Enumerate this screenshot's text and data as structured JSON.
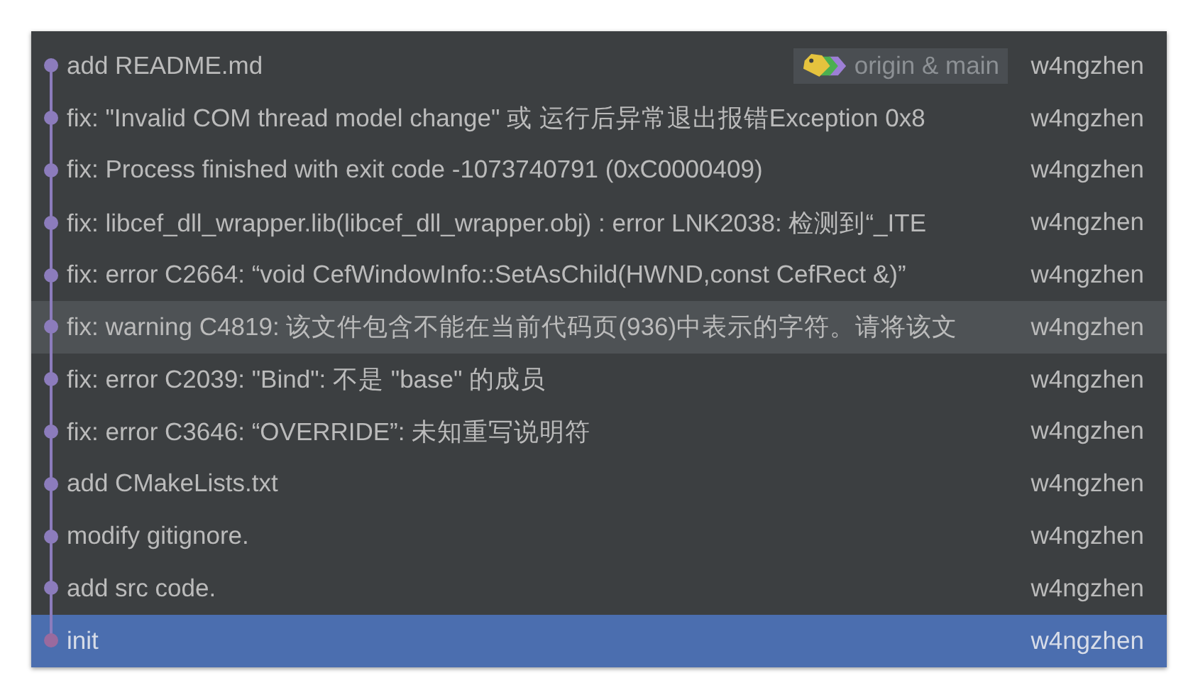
{
  "commits": [
    {
      "message": "add README.md",
      "ref": "origin & main",
      "author": "w4ngzhen",
      "selected": false,
      "hovered": false
    },
    {
      "message": "fix: \"Invalid COM thread model change\" 或 运行后异常退出报错Exception 0x8",
      "author": "w4ngzhen",
      "selected": false,
      "hovered": false
    },
    {
      "message": "fix: Process finished with exit code -1073740791 (0xC0000409)",
      "author": "w4ngzhen",
      "selected": false,
      "hovered": false
    },
    {
      "message": "fix: libcef_dll_wrapper.lib(libcef_dll_wrapper.obj) : error LNK2038: 检测到“_ITE",
      "author": "w4ngzhen",
      "selected": false,
      "hovered": false
    },
    {
      "message": "fix: error C2664: “void CefWindowInfo::SetAsChild(HWND,const CefRect &)”",
      "author": "w4ngzhen",
      "selected": false,
      "hovered": false
    },
    {
      "message": "fix: warning C4819: 该文件包含不能在当前代码页(936)中表示的字符。请将该文",
      "author": "w4ngzhen",
      "selected": false,
      "hovered": true
    },
    {
      "message": "fix: error C2039: \"Bind\": 不是 \"base\" 的成员",
      "author": "w4ngzhen",
      "selected": false,
      "hovered": false
    },
    {
      "message": "fix: error C3646: “OVERRIDE”: 未知重写说明符",
      "author": "w4ngzhen",
      "selected": false,
      "hovered": false
    },
    {
      "message": "add CMakeLists.txt",
      "author": "w4ngzhen",
      "selected": false,
      "hovered": false
    },
    {
      "message": "modify gitignore.",
      "author": "w4ngzhen",
      "selected": false,
      "hovered": false
    },
    {
      "message": "add src code.",
      "author": "w4ngzhen",
      "selected": false,
      "hovered": false
    },
    {
      "message": "init",
      "author": "w4ngzhen",
      "selected": true,
      "hovered": false
    }
  ]
}
